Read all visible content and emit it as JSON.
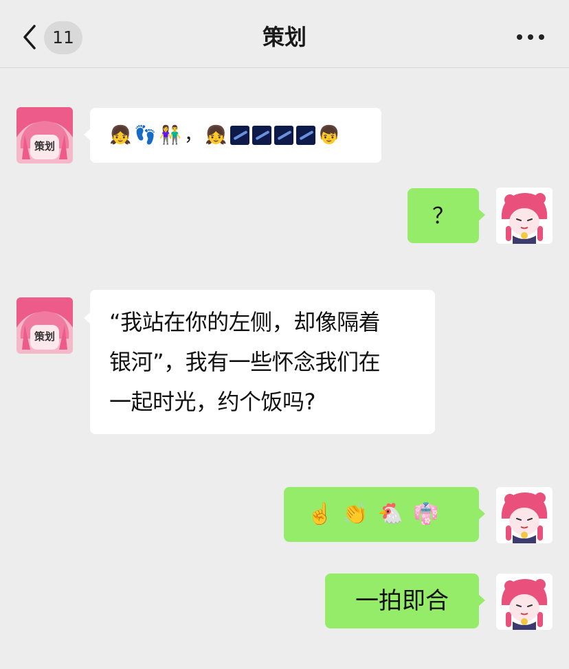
{
  "header": {
    "unread_count": "11",
    "title": "策划"
  },
  "contact": {
    "avatar_label": "策划"
  },
  "messages": [
    {
      "sender": "contact",
      "type": "emoji",
      "content": "👧👣👫，👧🌌🌌🌌🌌👦"
    },
    {
      "sender": "me",
      "type": "text",
      "content": "？"
    },
    {
      "sender": "contact",
      "type": "text",
      "content": "“我站在你的左侧，却像隔着\n银河”，我有一些怀念我们在\n一起时光，约个饭吗?"
    },
    {
      "sender": "me",
      "type": "emoji",
      "content": "☝️👏🐔👘"
    },
    {
      "sender": "me",
      "type": "text",
      "content": "一拍即合"
    }
  ],
  "colors": {
    "background": "#ededed",
    "incoming_bubble": "#ffffff",
    "outgoing_bubble": "#95ec69"
  }
}
